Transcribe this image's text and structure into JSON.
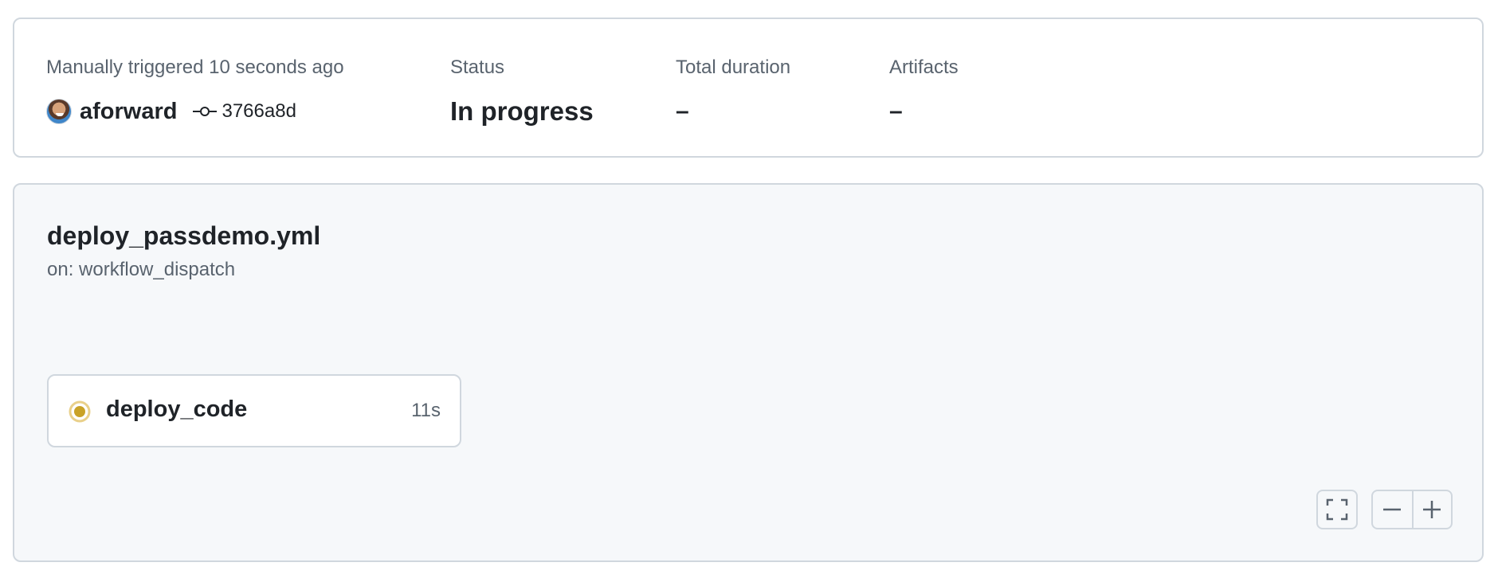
{
  "summary": {
    "trigger_label": "Manually triggered 10 seconds ago",
    "actor": "aforward",
    "commit_sha": "3766a8d",
    "status_label": "Status",
    "status_value": "In progress",
    "duration_label": "Total duration",
    "duration_value": "–",
    "artifacts_label": "Artifacts",
    "artifacts_value": "–"
  },
  "workflow": {
    "file_name": "deploy_passdemo.yml",
    "trigger": "on: workflow_dispatch",
    "jobs": [
      {
        "name": "deploy_code",
        "duration": "11s",
        "status": "in_progress",
        "status_icon": "in-progress-icon"
      }
    ]
  },
  "controls": {
    "fullscreen_icon": "fullscreen-icon",
    "zoom_out_icon": "zoom-out-icon",
    "zoom_in_icon": "zoom-in-icon"
  },
  "colors": {
    "in_progress": "#bf8700",
    "border": "#d0d7de",
    "muted_text": "#59636e",
    "canvas": "#f6f8fa"
  }
}
